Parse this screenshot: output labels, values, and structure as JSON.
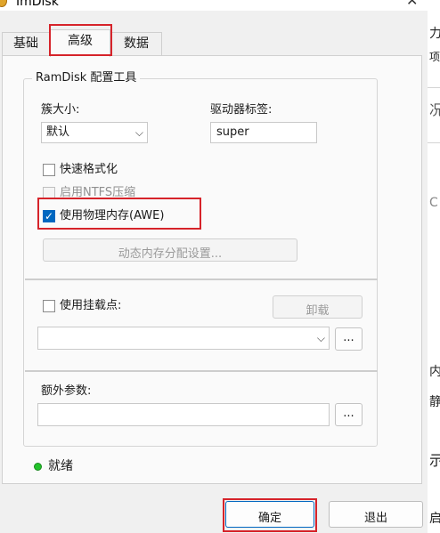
{
  "window": {
    "title": "ImDisk",
    "close": "✕"
  },
  "tabs": [
    {
      "label": "基础"
    },
    {
      "label": "高级"
    },
    {
      "label": "数据"
    }
  ],
  "group": {
    "title": "RamDisk 配置工具",
    "cluster_size_label": "簇大小:",
    "cluster_size_value": "默认",
    "drive_label_label": "驱动器标签:",
    "drive_label_value": "super",
    "quick_format": {
      "label": "快速格式化",
      "checked": false
    },
    "ntfs_compress": {
      "label": "启用NTFS压缩",
      "checked": false,
      "enabled": false
    },
    "use_awe": {
      "label": "使用物理内存(AWE)",
      "checked": true
    },
    "dynamic_memory_button": "动态内存分配设置...",
    "use_mount_point": {
      "label": "使用挂载点:",
      "checked": false
    },
    "unmount_button": "卸载",
    "mount_point_value": "",
    "browse_button": "...",
    "extra_params_label": "额外参数:",
    "extra_params_value": "",
    "extra_browse_button": "..."
  },
  "status": {
    "text": "就绪",
    "color": "#22c22a"
  },
  "footer": {
    "ok": "确定",
    "exit": "退出"
  },
  "background_window": {
    "glyphs": [
      "力",
      "项",
      "况",
      "C",
      "内",
      "静",
      "示",
      "启"
    ]
  },
  "colors": {
    "accent": "#0067c0",
    "highlight_box": "#d6232a"
  }
}
